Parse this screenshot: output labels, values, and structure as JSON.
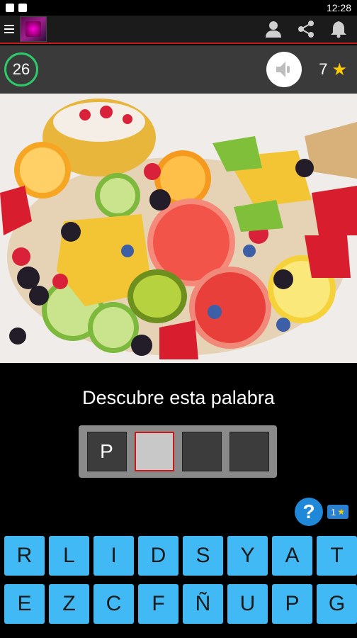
{
  "statusbar": {
    "time": "12:28"
  },
  "scorebar": {
    "level": "26",
    "stars": "7"
  },
  "question": {
    "title": "Descubre esta palabra"
  },
  "answer": {
    "slots": [
      "P",
      "",
      "",
      ""
    ]
  },
  "hint": {
    "label": "?",
    "cost": "1"
  },
  "keyboard": {
    "keys": [
      "R",
      "L",
      "I",
      "D",
      "S",
      "Y",
      "A",
      "T",
      "E",
      "Z",
      "C",
      "F",
      "Ñ",
      "U",
      "P",
      "G"
    ]
  },
  "colors": {
    "key": "#41b9f5",
    "accent": "#c81a1a",
    "level_ring": "#2ec96a",
    "hint": "#1f88d8",
    "star": "#ffcc00"
  },
  "icons": [
    "menu-icon",
    "app-logo",
    "user-icon",
    "share-icon",
    "bell-icon",
    "sound-icon",
    "star-icon",
    "help-icon"
  ]
}
